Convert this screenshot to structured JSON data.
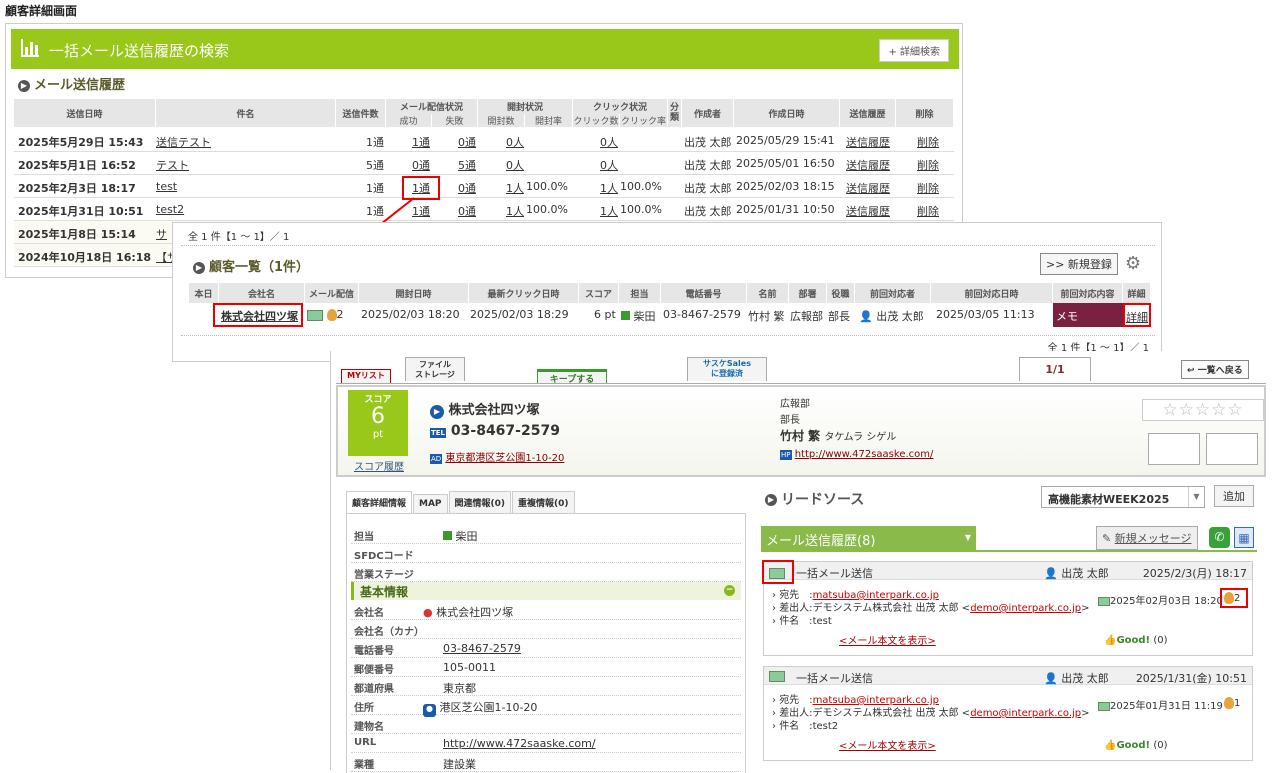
{
  "caption": "顧客詳細画面",
  "panel1": {
    "header_title": "一括メール送信履歴の検索",
    "advanced_search": "+ 詳細検索",
    "section_title": "メール送信履歴",
    "columns": {
      "send_date": "送信日時",
      "subject": "件名",
      "count": "送信件数",
      "delivery": "メール配信状況",
      "success": "成功",
      "failure": "失敗",
      "open": "開封状況",
      "opened": "開封数",
      "open_rate": "開封率",
      "click": "クリック状況",
      "clicks": "クリック数",
      "click_rate": "クリック率",
      "category": "分類",
      "creator": "作成者",
      "created": "作成日時",
      "history": "送信履歴",
      "delete": "削除"
    },
    "rows": [
      {
        "date": "2025年5月29日 15:43",
        "subject": "送信テスト",
        "count": "1通",
        "success": "1通",
        "failure": "0通",
        "opened": "0人",
        "open_rate": "",
        "clicks": "0人",
        "click_rate": "",
        "creator": "出茂 太郎",
        "created": "2025/05/29 15:41",
        "history": "送信履歴",
        "delete": "削除"
      },
      {
        "date": "2025年5月1日 16:52",
        "subject": "テスト",
        "count": "5通",
        "success": "0通",
        "failure": "5通",
        "opened": "0人",
        "open_rate": "",
        "clicks": "0人",
        "click_rate": "",
        "creator": "出茂 太郎",
        "created": "2025/05/01 16:50",
        "history": "送信履歴",
        "delete": "削除"
      },
      {
        "date": "2025年2月3日 18:17",
        "subject": "test",
        "count": "1通",
        "success": "1通",
        "failure": "0通",
        "opened": "1人",
        "open_rate": "100.0%",
        "clicks": "1人",
        "click_rate": "100.0%",
        "creator": "出茂 太郎",
        "created": "2025/02/03 18:15",
        "history": "送信履歴",
        "delete": "削除"
      },
      {
        "date": "2025年1月31日 10:51",
        "subject": "test2",
        "count": "1通",
        "success": "1通",
        "failure": "0通",
        "opened": "1人",
        "open_rate": "100.0%",
        "clicks": "1人",
        "click_rate": "100.0%",
        "creator": "出茂 太郎",
        "created": "2025/01/31 10:50",
        "history": "送信履歴",
        "delete": "削除"
      },
      {
        "date": "2025年1月8日 15:14",
        "subject": "サ"
      },
      {
        "date": "2024年10月18日 16:18",
        "subject": "【サ"
      }
    ]
  },
  "panel2": {
    "summary": "全 1 件【1 ～ 1】／ 1",
    "section_title": "顧客一覧（1件）",
    "new_button": ">> 新規登録",
    "columns": [
      "本日",
      "会社名",
      "メール配信",
      "開封日時",
      "最新クリック日時",
      "スコア",
      "担当",
      "電話番号",
      "名前",
      "部署",
      "役職",
      "前回対応者",
      "前回対応日時",
      "前回対応内容",
      "詳細"
    ],
    "row": {
      "company": "株式会社四ツ塚",
      "click_count": "2",
      "open_date": "2025/02/03 18:20",
      "click_date": "2025/02/03 18:29",
      "score": "6 pt",
      "owner": "柴田",
      "phone": "03-8467-2579",
      "name": "竹村 繁",
      "dept": "広報部",
      "title": "部長",
      "last_person": "出茂 太郎",
      "last_date": "2025/03/05 11:13",
      "last_content": "メモ",
      "detail": "詳細"
    },
    "footer": "全 1 件【1 ～ 1】／ 1"
  },
  "panel3": {
    "tabs": {
      "mylist": "MYリスト",
      "storage": "ファイル\nストレージ",
      "keep": "キープする",
      "sales": "サスケSales\nに登録済",
      "page": "1/1",
      "back": "一覧へ戻る"
    },
    "score_label": "スコア",
    "score_value": "6",
    "score_unit": "pt",
    "score_history": "スコア履歴",
    "company": "株式会社四ツ塚",
    "phone": "03-8467-2579",
    "address": "東京都港区芝公園1-10-20",
    "dept": "広報部",
    "title": "部長",
    "person": "竹村 繁",
    "person_kana": "タケムラ シゲル",
    "url": "http://www.472saaske.com/",
    "stars": "☆☆☆☆☆",
    "left_tabs": [
      "顧客詳細情報",
      "MAP",
      "関連情報(0)",
      "重複情報(0)"
    ],
    "basic_info": "基本情報",
    "info_top": [
      {
        "k": "担当",
        "v": "柴田"
      },
      {
        "k": "SFDCコード",
        "v": ""
      },
      {
        "k": "営業ステージ",
        "v": ""
      }
    ],
    "info_basic": [
      {
        "k": "会社名",
        "v": "株式会社四ツ塚"
      },
      {
        "k": "会社名（カナ）",
        "v": ""
      },
      {
        "k": "電話番号",
        "v": "03-8467-2579"
      },
      {
        "k": "郵便番号",
        "v": "105-0011"
      },
      {
        "k": "都道府県",
        "v": "東京都"
      },
      {
        "k": "住所",
        "v": "港区芝公園1-10-20"
      },
      {
        "k": "建物名",
        "v": ""
      },
      {
        "k": "URL",
        "v": "http://www.472saaske.com/"
      },
      {
        "k": "業種",
        "v": "建設業"
      }
    ],
    "lead_source_title": "リードソース",
    "lead_source_value": "高機能素材WEEK2025",
    "add_button": "追加",
    "mail_history_tab": "メール送信履歴(8)",
    "new_message": "新規メッセージ",
    "mails": [
      {
        "type": "一括メール送信",
        "sender_person": "出茂 太郎",
        "date": "2025/2/3(月) 18:17",
        "to": "matsuba@interpark.co.jp",
        "from": "デモシステム株式会社 出茂 太郎 <",
        "from_mail": "demo@interpark.co.jp",
        "subject": "test",
        "open_date": "2025年02月03日 18:20",
        "clicks": "2",
        "show": "<メール本文を表示>",
        "good": "Good!",
        "good_count": "(0)"
      },
      {
        "type": "一括メール送信",
        "sender_person": "出茂 太郎",
        "date": "2025/1/31(金) 10:51",
        "to": "matsuba@interpark.co.jp",
        "from": "デモシステム株式会社 出茂 太郎 <",
        "from_mail": "demo@interpark.co.jp",
        "subject": "test2",
        "open_date": "2025年01月31日 11:19",
        "clicks": "1",
        "show": "<メール本文を表示>",
        "good": "Good!",
        "good_count": "(0)"
      }
    ],
    "labels": {
      "to": "宛先　:",
      "from": "差出人:",
      "subject": "件名　:"
    }
  }
}
